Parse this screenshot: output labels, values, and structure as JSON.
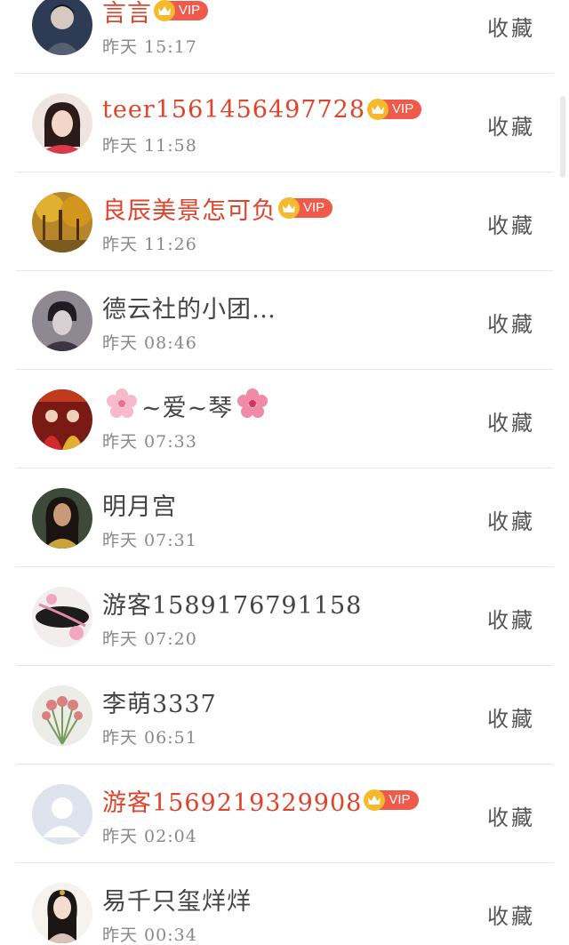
{
  "fav_label": "收藏",
  "vip_label": "VIP",
  "colors": {
    "vip_name": "#e0432b",
    "normal_name": "#444444",
    "time": "#888888",
    "vip_pill": "#ef5a4a",
    "crown": "#f6b92b"
  },
  "items": [
    {
      "name": "言言",
      "vip": true,
      "time": "昨天 15:17",
      "avatar": "portrait-dark"
    },
    {
      "name": "teer1561456497728",
      "vip": true,
      "time": "昨天 11:58",
      "avatar": "portrait-girl"
    },
    {
      "name": "良辰美景怎可负",
      "vip": true,
      "time": "昨天 11:26",
      "avatar": "autumn-forest"
    },
    {
      "name": "德云社的小团…",
      "vip": false,
      "time": "昨天 08:46",
      "avatar": "portrait-bw"
    },
    {
      "name": "~爱~琴",
      "vip": false,
      "time": "昨天 07:33",
      "avatar": "drama-poster"
    },
    {
      "name": "明月宫",
      "vip": false,
      "time": "昨天 07:31",
      "avatar": "portrait-woman"
    },
    {
      "name": "游客1589176791158",
      "vip": false,
      "time": "昨天 07:20",
      "avatar": "flowers-fan"
    },
    {
      "name": "李萌3337",
      "vip": false,
      "time": "昨天 06:51",
      "avatar": "flower-bouquet"
    },
    {
      "name": "游客1569219329908",
      "vip": true,
      "time": "昨天 02:04",
      "avatar": "default-user"
    },
    {
      "name": "易千只玺烊烊",
      "vip": false,
      "time": "昨天 00:34",
      "avatar": "ancient-lady"
    }
  ]
}
